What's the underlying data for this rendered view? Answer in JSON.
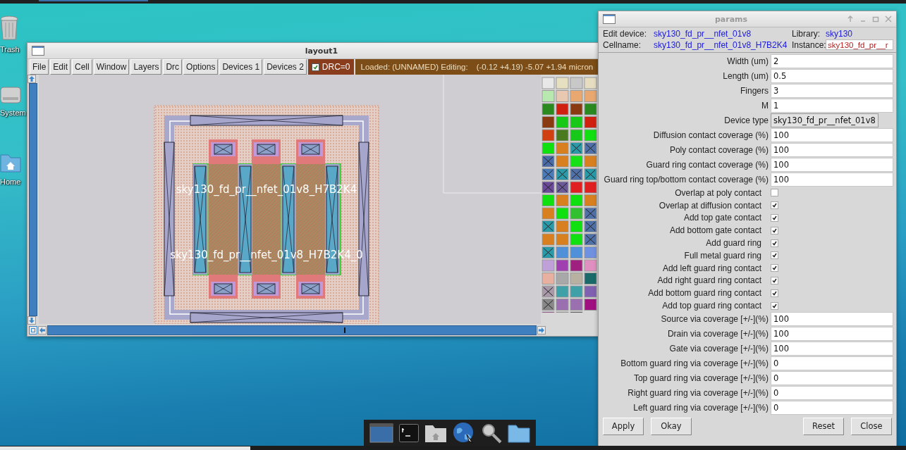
{
  "desktop_icons": [
    {
      "kind": "trash",
      "label": "Trash"
    },
    {
      "kind": "drive",
      "label": "System"
    },
    {
      "kind": "home",
      "label": "Home"
    }
  ],
  "layout_window": {
    "title": "layout1",
    "menu": [
      "File",
      "Edit",
      "Cell",
      "Window",
      "Layers",
      "Drc",
      "Options",
      "Devices 1",
      "Devices 2"
    ],
    "drc": {
      "label": "DRC=0",
      "checked": true
    },
    "status": "Loaded: (UNNAMED) Editing:",
    "coordinates": "(-0.12 +4.19) -5.07 +1.94 micron",
    "cell_labels": [
      "sky130_fd_pr__nfet_01v8_H7B2K4",
      "sky130_fd_pr__nfet_01v8_H7B2K4_0"
    ]
  },
  "params_window": {
    "title": "params",
    "edit_device": {
      "label": "Edit device:",
      "value": "sky130_fd_pr__nfet_01v8"
    },
    "library": {
      "label": "Library:",
      "value": "sky130"
    },
    "cellname": {
      "label": "Cellname:",
      "value": "sky130_fd_pr__nfet_01v8_H7B2K4"
    },
    "instance": {
      "label": "Instance:",
      "value": "sky130_fd_pr__r"
    },
    "fields": [
      {
        "kind": "entry",
        "label": "Width (um)",
        "value": "2"
      },
      {
        "kind": "entry",
        "label": "Length (um)",
        "value": "0.5"
      },
      {
        "kind": "entry",
        "label": "Fingers",
        "value": "3"
      },
      {
        "kind": "entry",
        "label": "M",
        "value": "1"
      },
      {
        "kind": "menu",
        "label": "Device type",
        "value": "sky130_fd_pr__nfet_01v8"
      },
      {
        "kind": "entry",
        "label": "Diffusion contact coverage (%)",
        "value": "100"
      },
      {
        "kind": "entry",
        "label": "Poly contact coverage (%)",
        "value": "100"
      },
      {
        "kind": "entry",
        "label": "Guard ring contact coverage (%)",
        "value": "100"
      },
      {
        "kind": "entry",
        "label": "Guard ring top/bottom contact coverage (%)",
        "value": "100"
      },
      {
        "kind": "check",
        "label": "Overlap at poly contact",
        "checked": false
      },
      {
        "kind": "check",
        "label": "Overlap at diffusion contact",
        "checked": true
      },
      {
        "kind": "check",
        "label": "Add top gate contact",
        "checked": true
      },
      {
        "kind": "check",
        "label": "Add bottom gate contact",
        "checked": true
      },
      {
        "kind": "check",
        "label": "Add guard ring",
        "checked": true
      },
      {
        "kind": "check",
        "label": "Full metal guard ring",
        "checked": true
      },
      {
        "kind": "check",
        "label": "Add left guard ring contact",
        "checked": true
      },
      {
        "kind": "check",
        "label": "Add right guard ring contact",
        "checked": true
      },
      {
        "kind": "check",
        "label": "Add bottom guard ring contact",
        "checked": true
      },
      {
        "kind": "check",
        "label": "Add top guard ring contact",
        "checked": true
      },
      {
        "kind": "entry",
        "label": "Source via coverage [+/-](%)",
        "value": "100"
      },
      {
        "kind": "entry",
        "label": "Drain via coverage [+/-](%)",
        "value": "100"
      },
      {
        "kind": "entry",
        "label": "Gate via coverage [+/-](%)",
        "value": "100"
      },
      {
        "kind": "entry",
        "label": "Bottom guard ring via coverage [+/-](%)",
        "value": "0"
      },
      {
        "kind": "entry",
        "label": "Top guard ring via coverage [+/-](%)",
        "value": "0"
      },
      {
        "kind": "entry",
        "label": "Right guard ring via coverage [+/-](%)",
        "value": "0"
      },
      {
        "kind": "entry",
        "label": "Left guard ring via coverage [+/-](%)",
        "value": "0"
      }
    ],
    "buttons_left": [
      "Apply",
      "Okay"
    ],
    "buttons_right": [
      "Reset",
      "Close"
    ]
  }
}
